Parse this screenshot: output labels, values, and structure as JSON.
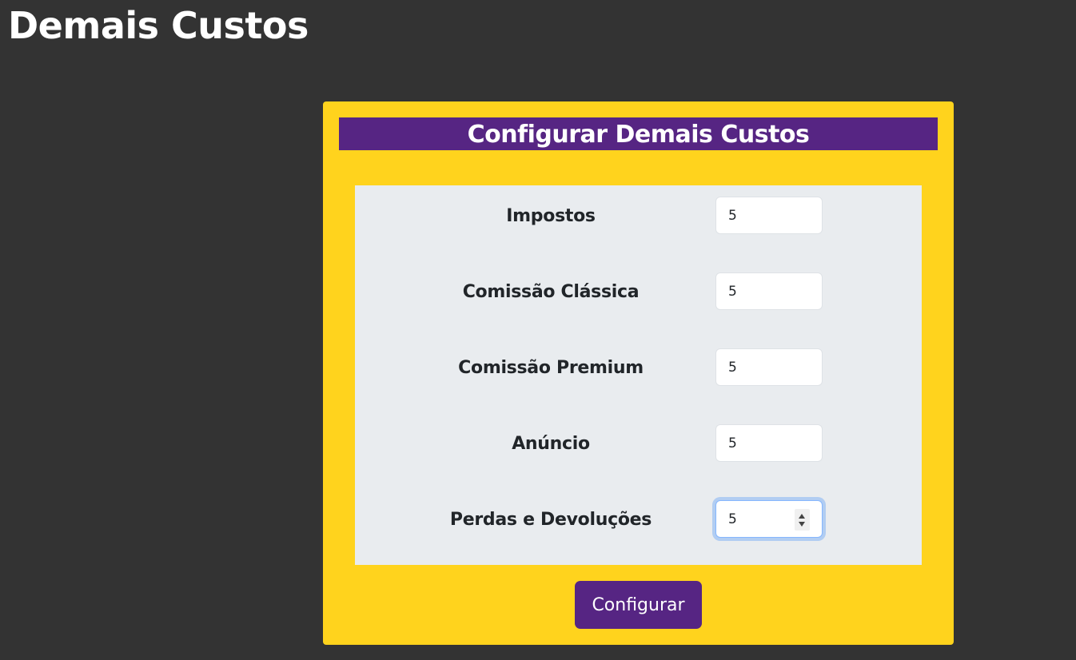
{
  "page": {
    "title": "Demais Custos"
  },
  "card": {
    "header": "Configurar Demais Custos",
    "fields": [
      {
        "label": "Impostos",
        "value": "5"
      },
      {
        "label": "Comissão Clássica",
        "value": "5"
      },
      {
        "label": "Comissão Premium",
        "value": "5"
      },
      {
        "label": "Anúncio",
        "value": "5"
      },
      {
        "label": "Perdas e Devoluções",
        "value": "5"
      }
    ],
    "submit_label": "Configurar"
  },
  "colors": {
    "background": "#333333",
    "card_background": "#ffd31d",
    "accent": "#562583",
    "panel": "#e9ecef"
  }
}
